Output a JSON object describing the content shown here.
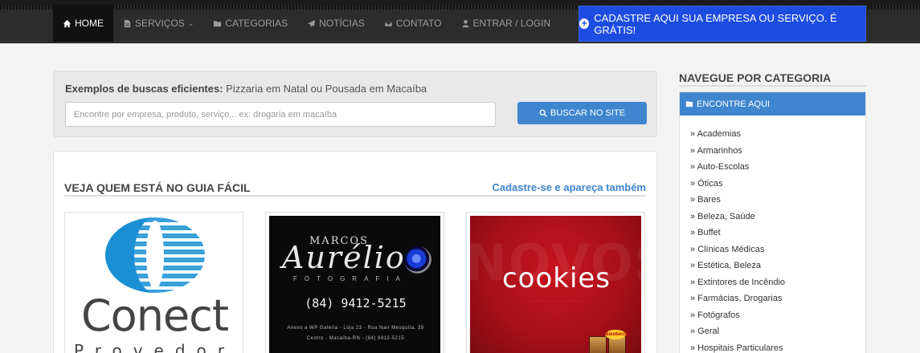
{
  "nav": {
    "items": [
      {
        "label": "HOME",
        "icon": "home-icon",
        "active": true
      },
      {
        "label": "SERVIÇOS",
        "icon": "file-icon",
        "dropdown": true
      },
      {
        "label": "CATEGORIAS",
        "icon": "folder-icon"
      },
      {
        "label": "NOTÍCIAS",
        "icon": "paper-plane-icon"
      },
      {
        "label": "CONTATO",
        "icon": "envelope-icon"
      },
      {
        "label": "ENTRAR / LOGIN",
        "icon": "user-icon"
      }
    ],
    "cta_label": "CADASTRE AQUI SUA EMPRESA OU SERVIÇO. É GRÁTIS!"
  },
  "search": {
    "hint_bold": "Exemplos de buscas eficientes:",
    "hint_text": " Pizzaria em Natal ou Pousada em Macaíba",
    "placeholder": "Encontre por empresa, produto, serviço... ex: drogaria em macaíba",
    "button_label": "BUSCAR NO SITE"
  },
  "featured": {
    "title": "VEJA QUEM ESTÁ NO GUIA FÁCIL",
    "link": "Cadastre-se e apareça também",
    "cards": [
      {
        "name": "Conect",
        "subtitle": "Provedor"
      },
      {
        "name_small": "MARCOS",
        "name_big": "Aurélio",
        "tagline": "FOTOGRAFIA",
        "phone": "(84) 9412-5215",
        "address_1": "Anexo a WP Galeria - Loja 23 - Rua Nair Mesquita, 39",
        "address_2": "Centro - Macaíba-RN - (84) 9412-5215"
      },
      {
        "bg_word": "NOVOS",
        "name": "cookies",
        "brand": "Bauducco"
      }
    ]
  },
  "sidebar": {
    "title": "NAVEGUE POR CATEGORIA",
    "panel_title": "ENCONTRE AQUI",
    "categories": [
      "» Academias",
      "» Armarinhos",
      "» Auto-Escolas",
      "» Óticas",
      "» Bares",
      "» Beleza, Saúde",
      "» Buffet",
      "» Clínicas Médicas",
      "» Estética, Beleza",
      "» Extintores de Incêndio",
      "» Farmácias, Drogarias",
      "» Fotógrafos",
      "» Geral",
      "» Hospitais Particulares"
    ]
  },
  "colors": {
    "accent_blue": "#3f86cf",
    "cta_blue": "#1d4ce0",
    "nav_bg": "#2c2c2c"
  }
}
